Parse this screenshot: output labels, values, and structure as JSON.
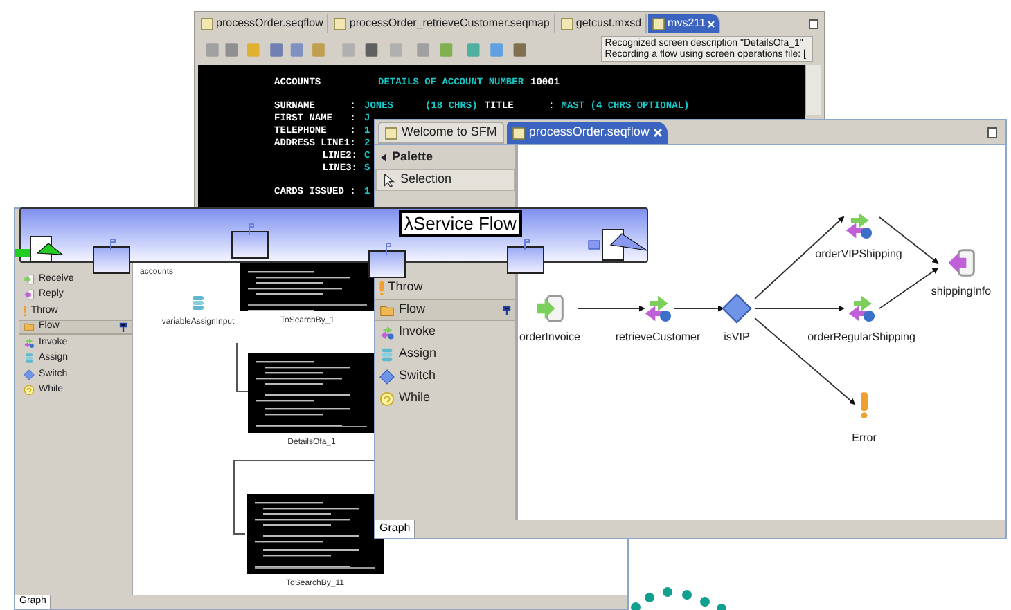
{
  "terminal_window": {
    "tabs": [
      {
        "label": "processOrder.seqflow",
        "selected": false
      },
      {
        "label": "processOrder_retrieveCustomer.seqmap",
        "selected": false
      },
      {
        "label": "getcust.mxsd",
        "selected": false
      },
      {
        "label": "mvs211",
        "selected": true
      }
    ],
    "status_lines": [
      "Recognized screen description \"DetailsOfa_1\"",
      "Recording a flow using screen operations file: ["
    ],
    "screen_lines": [
      [
        {
          "kind": "title",
          "text": "ACCOUNTS",
          "color": "#ffffff"
        },
        {
          "kind": "value",
          "text": "DETAILS OF ACCOUNT NUMBER",
          "color": "#19c8c8"
        },
        {
          "kind": "value",
          "text": "10001",
          "color": "#ffffff"
        }
      ],
      [
        {
          "kind": "label",
          "text": "SURNAME      :",
          "color": "#ffffff"
        },
        {
          "kind": "value",
          "text": "JONES",
          "color": "#19c8c8"
        },
        {
          "kind": "gap",
          "text": "(18 CHRS)",
          "color": "#19c8c8"
        },
        {
          "kind": "value",
          "text": "TITLE      :",
          "color": "#ffffff"
        },
        {
          "kind": "value",
          "text": "MAST (4 CHRS OPTIONAL)",
          "color": "#19c8c8"
        }
      ],
      [
        {
          "kind": "label",
          "text": "FIRST NAME   :",
          "color": "#ffffff"
        },
        {
          "kind": "value",
          "text": "J",
          "color": "#19c8c8"
        }
      ],
      [
        {
          "kind": "label",
          "text": "TELEPHONE    :",
          "color": "#ffffff"
        },
        {
          "kind": "value",
          "text": "1",
          "color": "#19c8c8"
        }
      ],
      [
        {
          "kind": "label",
          "text": "ADDRESS LINE1:",
          "color": "#ffffff"
        },
        {
          "kind": "value",
          "text": "2",
          "color": "#19c8c8"
        }
      ],
      [
        {
          "kind": "sublabel",
          "text": "LINE2:",
          "color": "#ffffff"
        },
        {
          "kind": "value",
          "text": "C",
          "color": "#19c8c8"
        }
      ],
      [
        {
          "kind": "sublabel",
          "text": "LINE3:",
          "color": "#ffffff"
        },
        {
          "kind": "value",
          "text": "S",
          "color": "#19c8c8"
        }
      ],
      [
        {
          "kind": "label",
          "text": "CARDS ISSUED :",
          "color": "#ffffff"
        },
        {
          "kind": "value",
          "text": "1",
          "color": "#19c8c8"
        }
      ]
    ]
  },
  "left_editor": {
    "palette": [
      {
        "label": "Receive",
        "kind": "receive"
      },
      {
        "label": "Reply",
        "kind": "reply"
      },
      {
        "label": "Throw",
        "kind": "throw"
      },
      {
        "label": "Flow",
        "kind": "drawer"
      },
      {
        "label": "Invoke",
        "kind": "invoke"
      },
      {
        "label": "Assign",
        "kind": "assign"
      },
      {
        "label": "Switch",
        "kind": "switch"
      },
      {
        "label": "While",
        "kind": "while"
      }
    ],
    "canvas_nodes": [
      {
        "label": "accounts",
        "kind": "text"
      },
      {
        "label": "variableAssignInput",
        "kind": "assign"
      },
      {
        "label": "ToSearchBy_1",
        "kind": "screen"
      },
      {
        "label": "DetailsOfa_1",
        "kind": "screen"
      },
      {
        "label": "ToSearchBy_11",
        "kind": "screen"
      }
    ],
    "bottom_tab": "Graph"
  },
  "front_editor": {
    "tabs": [
      {
        "label": "Welcome to SFM",
        "selected": false
      },
      {
        "label": "processOrder.seqflow",
        "selected": true
      }
    ],
    "palette": [
      {
        "label": "Palette",
        "kind": "header"
      },
      {
        "label": "Selection",
        "kind": "selection"
      },
      {
        "label": "Throw",
        "kind": "throw"
      },
      {
        "label": "Flow",
        "kind": "drawer"
      },
      {
        "label": "Invoke",
        "kind": "invoke"
      },
      {
        "label": "Assign",
        "kind": "assign"
      },
      {
        "label": "Switch",
        "kind": "switch"
      },
      {
        "label": "While",
        "kind": "while"
      }
    ],
    "canvas_nodes": [
      {
        "label": "orderInvoice",
        "kind": "input"
      },
      {
        "label": "retrieveCustomer",
        "kind": "invoke"
      },
      {
        "label": "isVIP",
        "kind": "switch"
      },
      {
        "label": "orderVIPShipping",
        "kind": "invoke"
      },
      {
        "label": "orderRegularShipping",
        "kind": "invoke"
      },
      {
        "label": "shippingInfo",
        "kind": "output"
      },
      {
        "label": "Error",
        "kind": "error"
      }
    ],
    "bottom_tab": "Graph"
  },
  "service_flow_banner": {
    "title": "λService Flow"
  }
}
